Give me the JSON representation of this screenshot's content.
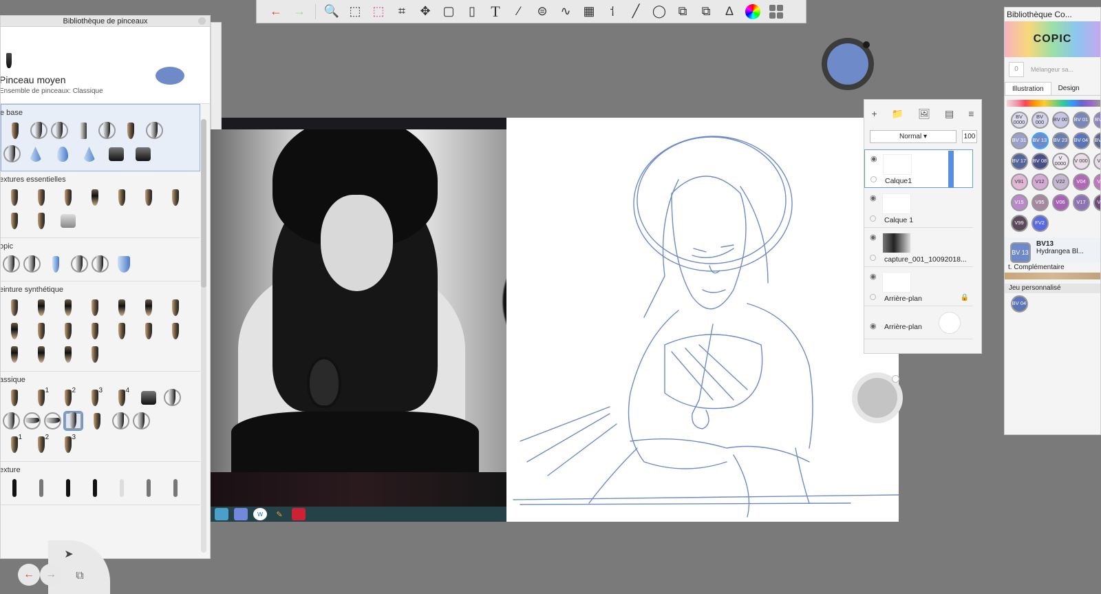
{
  "toolbar": {
    "icons": [
      "undo-icon",
      "redo-icon",
      "zoom-icon",
      "select-rect-icon",
      "lasso-icon",
      "crop-icon",
      "transform-icon",
      "distort-icon",
      "bucket-icon",
      "text-icon",
      "ruler-icon",
      "ellipse-guide-icon",
      "curve-icon",
      "perspective-icon",
      "symmetry-icon",
      "stroke-icon",
      "circle-icon",
      "shape-icon",
      "layers-icon",
      "brush-library-icon",
      "color-wheel-icon",
      "palette-icon"
    ],
    "text_glyph": "T"
  },
  "brush_library": {
    "title": "Bibliothèque de pinceaux",
    "current_brush": "Pinceau moyen",
    "brush_set": "Ensemble de pinceaux: Classique",
    "current_color": "#6f8ac8",
    "sections": [
      {
        "name": "e base",
        "rows": 2
      },
      {
        "name": "extures essentielles",
        "rows": 2
      },
      {
        "name": "opic",
        "rows": 1
      },
      {
        "name": "einture synthétique",
        "rows": 3
      },
      {
        "name": "assique",
        "rows": 3,
        "numbers": [
          "1",
          "2",
          "3",
          "4",
          "1",
          "2",
          "3"
        ]
      },
      {
        "name": "exture",
        "rows": 1
      }
    ]
  },
  "layers": {
    "blend_mode": "Normal",
    "opacity": "100",
    "items": [
      {
        "name": "Calque1",
        "selected": true
      },
      {
        "name": "Calque 1",
        "selected": false
      },
      {
        "name": "capture_001_10092018...",
        "selected": false
      },
      {
        "name": "Arrière-plan",
        "selected": false
      },
      {
        "name": "Arrière-plan",
        "selected": false
      }
    ]
  },
  "copic": {
    "title": "Bibliothèque Co...",
    "logo": "COPIC",
    "mixer_value": "0",
    "mixer_label": "Mélangeur sa...",
    "tabs": [
      "Illustration",
      "Design"
    ],
    "pens": [
      {
        "code": "BV 0000",
        "color": "#dcdcee",
        "light": true
      },
      {
        "code": "BV 000",
        "color": "#d2d2ea",
        "light": true
      },
      {
        "code": "BV 00",
        "color": "#c6c6e4",
        "light": true
      },
      {
        "code": "BV 01",
        "color": "#7b86b8"
      },
      {
        "code": "BV 11",
        "color": "#8a84c0"
      },
      {
        "code": "BV 31",
        "color": "#9aa0c8"
      },
      {
        "code": "BV 13",
        "color": "#6f8ac8",
        "selected": true
      },
      {
        "code": "BV 23",
        "color": "#6a7eb0"
      },
      {
        "code": "BV 04",
        "color": "#5d74b8"
      },
      {
        "code": "BV 25",
        "color": "#5a6892"
      },
      {
        "code": "BV 17",
        "color": "#55659a"
      },
      {
        "code": "BV 08",
        "color": "#4a4f86"
      },
      {
        "code": "V 0000",
        "color": "#efe6ef",
        "light": true
      },
      {
        "code": "V 000",
        "color": "#e9dde9",
        "light": true
      },
      {
        "code": "V20",
        "color": "#e6dde8",
        "light": true
      },
      {
        "code": "V91",
        "color": "#e2b7d6",
        "light": true
      },
      {
        "code": "V12",
        "color": "#d6a9d6",
        "light": true
      },
      {
        "code": "V22",
        "color": "#c5b7d0",
        "light": true
      },
      {
        "code": "V04",
        "color": "#b268b8"
      },
      {
        "code": "V05",
        "color": "#c077c0"
      },
      {
        "code": "V15",
        "color": "#b88ac8"
      },
      {
        "code": "V95",
        "color": "#a688a0"
      },
      {
        "code": "V06",
        "color": "#a864b4"
      },
      {
        "code": "V17",
        "color": "#8e74b4"
      },
      {
        "code": "V09",
        "color": "#6e4c7a"
      },
      {
        "code": "V99",
        "color": "#5c4a5c"
      },
      {
        "code": "FV2",
        "color": "#5a6ae0"
      }
    ],
    "selected_code": "BV13",
    "selected_name": "Hydrangea Bl...",
    "selected_short": "BV 13",
    "complementary_label": "t. Complémentaire",
    "custom_label": "Jeu personnalisé",
    "custom_pen": "BV 04"
  },
  "colors": {
    "accent": "#6a9bd8",
    "stroke": "#6f8ac8"
  }
}
